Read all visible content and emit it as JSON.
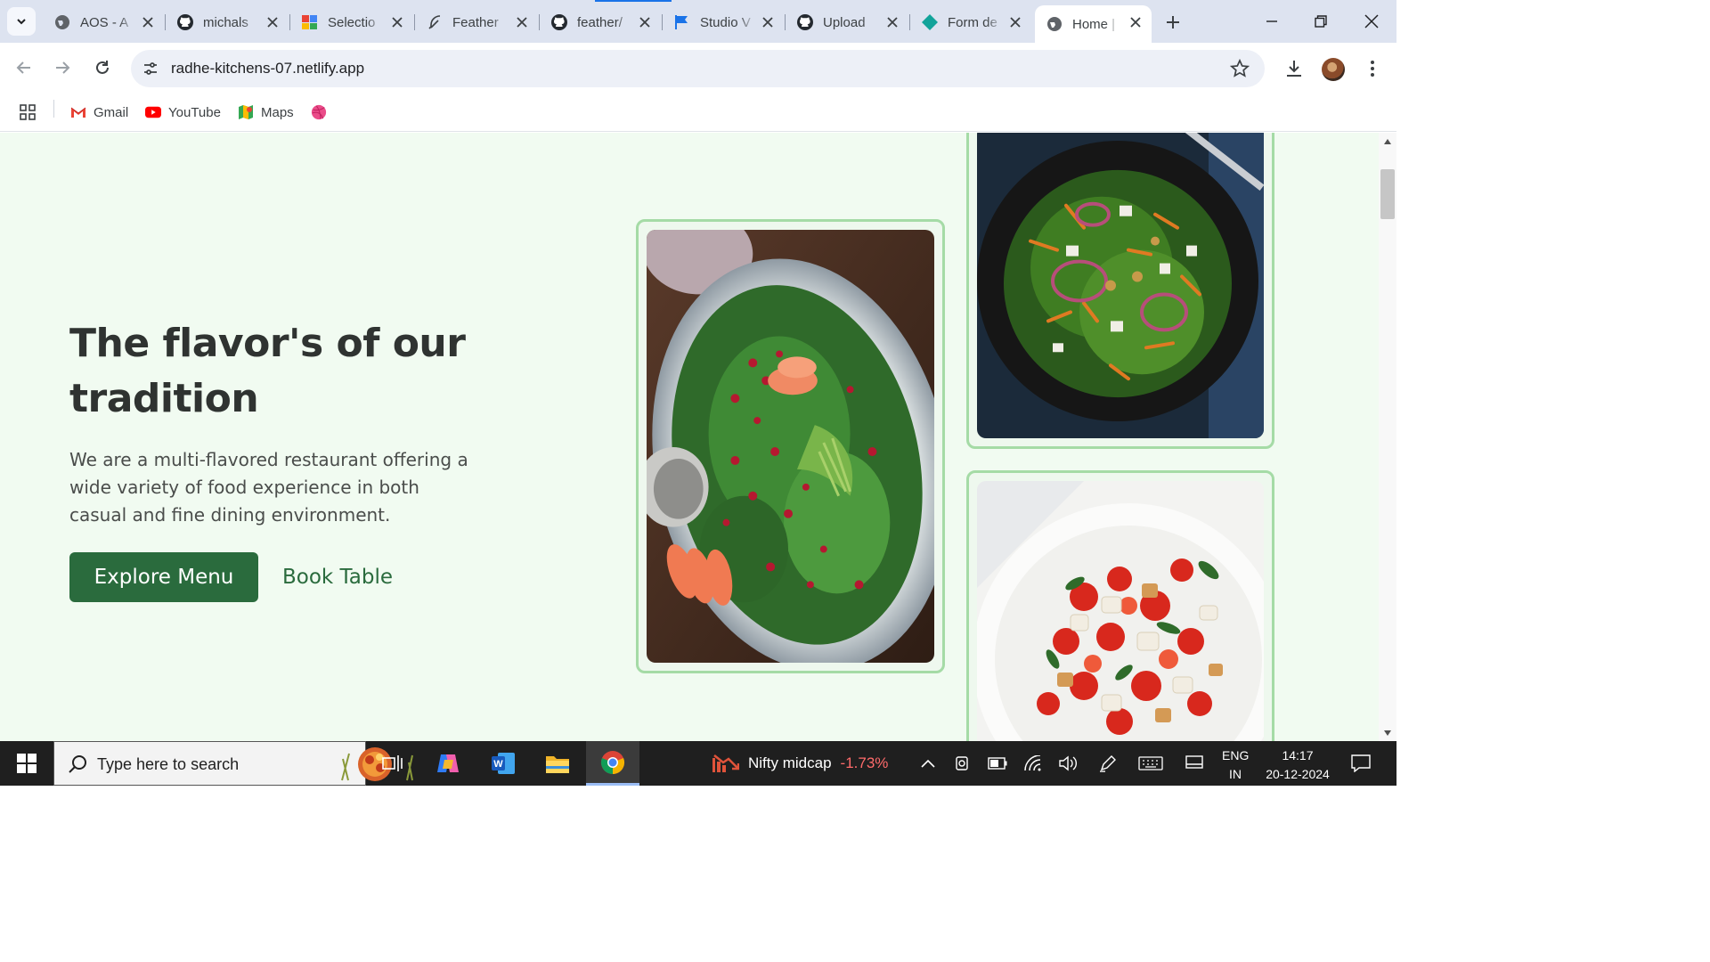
{
  "browser": {
    "tabs": [
      {
        "label": "AOS - A",
        "icon": "globe-icon"
      },
      {
        "label": "michals",
        "icon": "github-icon"
      },
      {
        "label": "Selectio",
        "icon": "selection-icon"
      },
      {
        "label": "Feather",
        "icon": "feather-icon"
      },
      {
        "label": "feather/",
        "icon": "github-icon"
      },
      {
        "label": "Studio V",
        "icon": "flag-icon"
      },
      {
        "label": "Upload",
        "icon": "github-icon"
      },
      {
        "label": "Form de",
        "icon": "diamond-icon"
      },
      {
        "label": "Home |",
        "icon": "globe-icon",
        "active": true
      }
    ],
    "url": "radhe-kitchens-07.netlify.app",
    "bookmarks": [
      {
        "label": "Gmail",
        "icon": "gmail-icon"
      },
      {
        "label": "YouTube",
        "icon": "youtube-icon"
      },
      {
        "label": "Maps",
        "icon": "maps-icon"
      },
      {
        "label": "",
        "icon": "dribbble-icon"
      }
    ]
  },
  "hero": {
    "title": "The flavor's of our tradition",
    "description": "We are a multi-flavored restaurant offering a wide variety of food experience in both casual and fine dining environment.",
    "primary_button": "Explore Menu",
    "secondary_button": "Book Table"
  },
  "taskbar": {
    "search_placeholder": "Type here to search",
    "stock_name": "Nifty midcap",
    "stock_change": "-1.73%",
    "lang_top": "ENG",
    "lang_bottom": "IN",
    "time": "14:17",
    "date": "20-12-2024"
  },
  "colors": {
    "brand_green": "#2a6b3d",
    "page_bg": "#f1fbf1",
    "card_border": "#a5dba6",
    "stock_negative": "#ff6b6b"
  }
}
